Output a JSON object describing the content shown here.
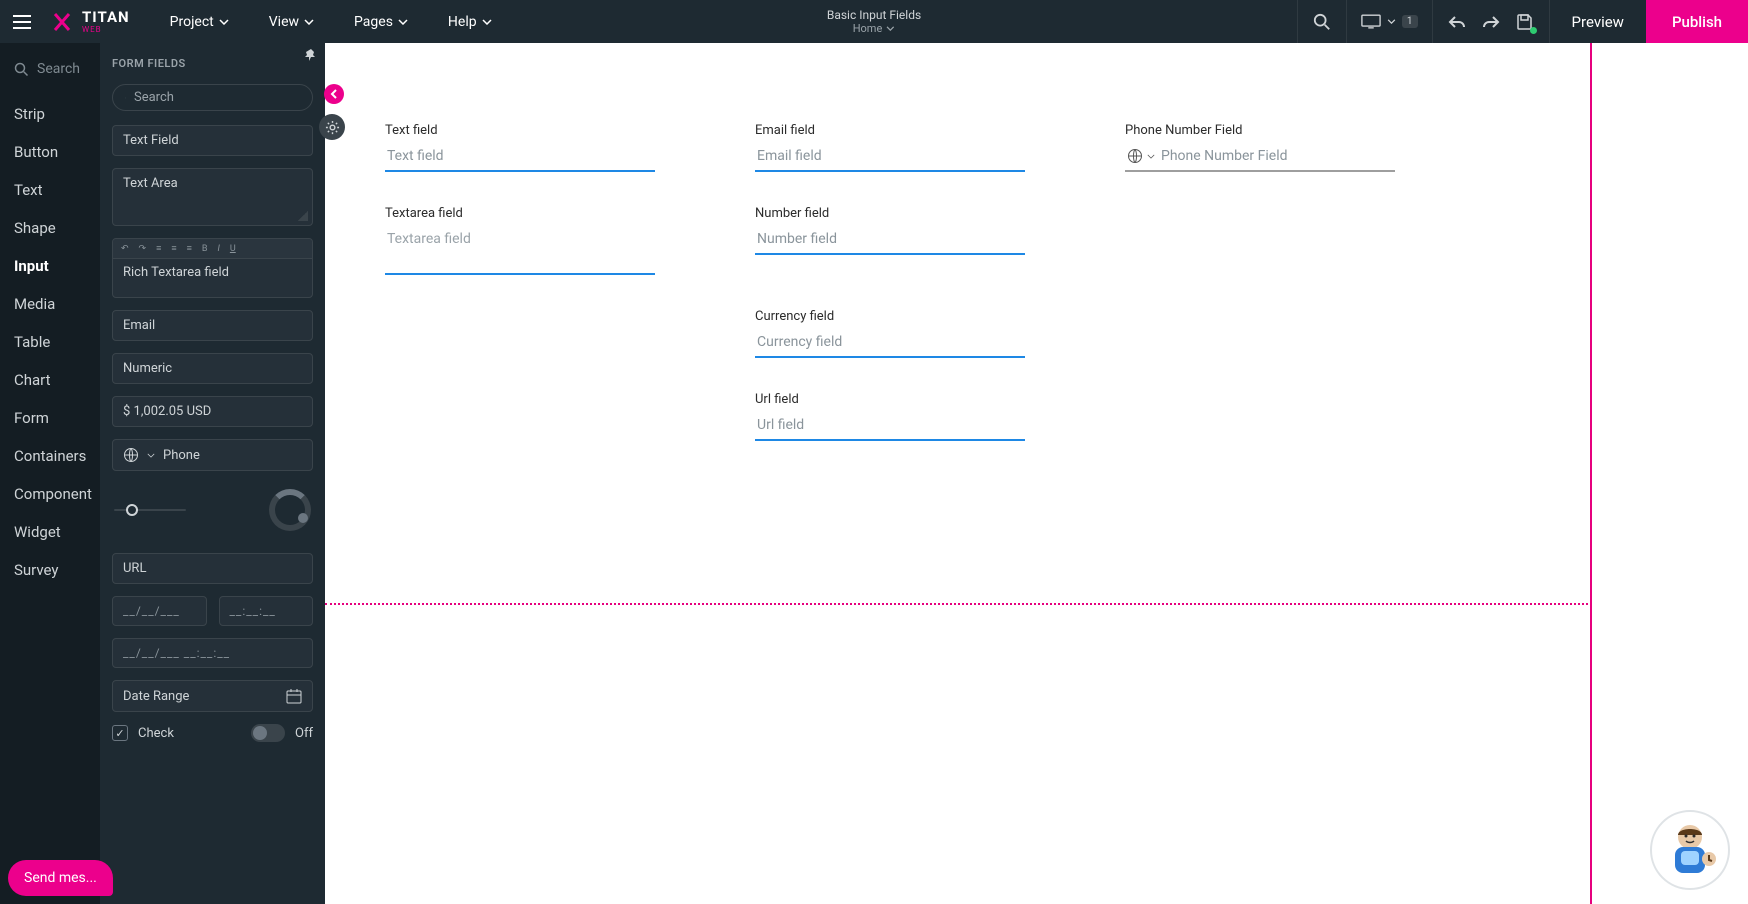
{
  "brand": {
    "name": "TITAN",
    "sub": "WEB"
  },
  "menus": {
    "project": "Project",
    "view": "View",
    "pages": "Pages",
    "help": "Help"
  },
  "doc": {
    "title": "Basic Input Fields",
    "page": "Home"
  },
  "actions": {
    "preview": "Preview",
    "publish": "Publish"
  },
  "device_count": "1",
  "left_rail": {
    "search": "Search",
    "items": [
      "Strip",
      "Button",
      "Text",
      "Shape",
      "Input",
      "Media",
      "Table",
      "Chart",
      "Form",
      "Containers",
      "Component",
      "Widget",
      "Survey"
    ],
    "active_index": 4
  },
  "panel": {
    "header": "FORM FIELDS",
    "search_placeholder": "Search",
    "text_field": "Text Field",
    "text_area": "Text Area",
    "rich_textarea": "Rich Textarea field",
    "rich_toolbar": {
      "bold": "B",
      "italic": "I",
      "underline": "U"
    },
    "email": "Email",
    "numeric": "Numeric",
    "currency": "$ 1,002.05 USD",
    "phone": "Phone",
    "url": "URL",
    "date_fmt": "__/__/___",
    "time_fmt": "__:__:__",
    "datetime_fmt": "__/__/___     __:__:__",
    "daterange": "Date Range",
    "check": "Check",
    "off": "Off"
  },
  "canvas": {
    "text": {
      "label": "Text field",
      "placeholder": "Text field"
    },
    "email": {
      "label": "Email field",
      "placeholder": "Email field"
    },
    "phone": {
      "label": "Phone Number Field",
      "placeholder": "Phone Number Field"
    },
    "textarea": {
      "label": "Textarea field",
      "placeholder": "Textarea field"
    },
    "number": {
      "label": "Number field",
      "placeholder": "Number field"
    },
    "currency": {
      "label": "Currency field",
      "placeholder": "Currency field"
    },
    "url": {
      "label": "Url field",
      "placeholder": "Url field"
    }
  },
  "chat": {
    "send": "Send mes..."
  }
}
